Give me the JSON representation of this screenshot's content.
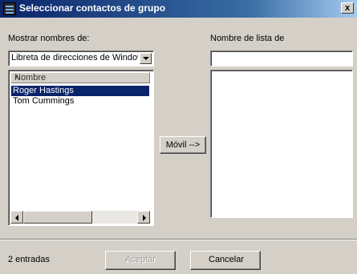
{
  "window": {
    "title": "Seleccionar contactos de grupo",
    "close_glyph": "x"
  },
  "left": {
    "label": "Mostrar nombres de:",
    "combo_value": "Libreta de direcciones de Windows",
    "column_header": "Nombre",
    "items": [
      {
        "label": "Roger Hastings",
        "selected": true
      },
      {
        "label": "Tom Cummings",
        "selected": false
      }
    ]
  },
  "right": {
    "label": "Nombre de lista de",
    "input_value": ""
  },
  "move_button": "Móvil -->",
  "footer": {
    "status": "2 entradas",
    "accept_label": "Aceptar",
    "cancel_label": "Cancelar"
  },
  "colors": {
    "title_gradient_start": "#0a246a",
    "selection": "#0a246a",
    "face": "#d4d0c8"
  }
}
